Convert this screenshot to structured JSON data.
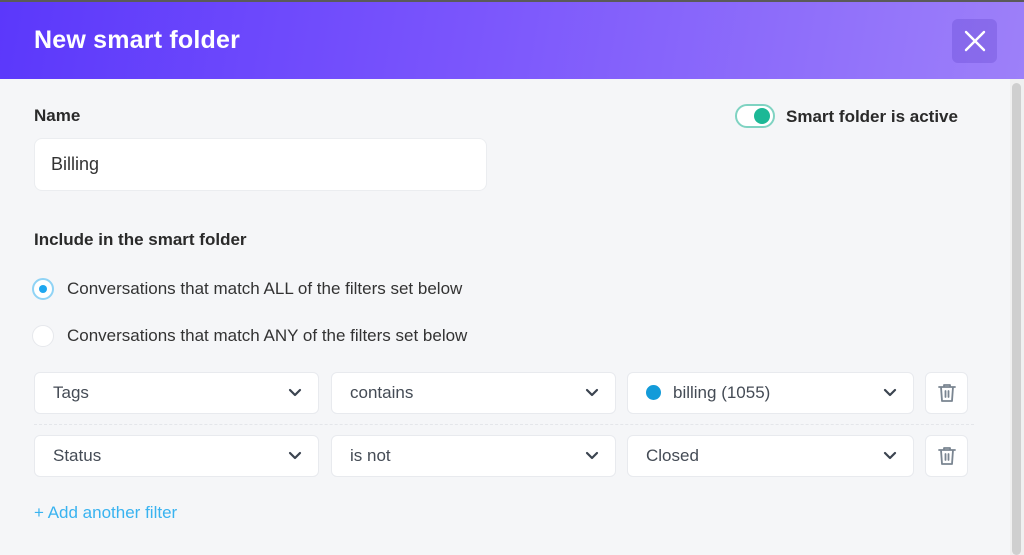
{
  "header": {
    "title": "New smart folder",
    "close_icon": "close-icon"
  },
  "form": {
    "name_label": "Name",
    "name_value": "Billing",
    "active_toggle": {
      "label": "Smart folder is active",
      "on": true
    },
    "include_label": "Include in the smart folder",
    "match_options": [
      {
        "label": "Conversations that match ALL of the filters set below",
        "selected": true
      },
      {
        "label": "Conversations that match ANY of the filters set below",
        "selected": false
      }
    ]
  },
  "filters": [
    {
      "field": "Tags",
      "operator": "contains",
      "value": "billing (1055)",
      "value_color": "#139bd9",
      "delete_icon": "trash-icon"
    },
    {
      "field": "Status",
      "operator": "is not",
      "value": "Closed",
      "delete_icon": "trash-icon"
    }
  ],
  "add_filter_label": "+ Add another filter",
  "colors": {
    "header_gradient_start": "#5b38fb",
    "header_gradient_end": "#9d80f9",
    "toggle_on": "#1cb896",
    "radio_selected": "#1ea7f0",
    "link": "#39b3f0"
  }
}
